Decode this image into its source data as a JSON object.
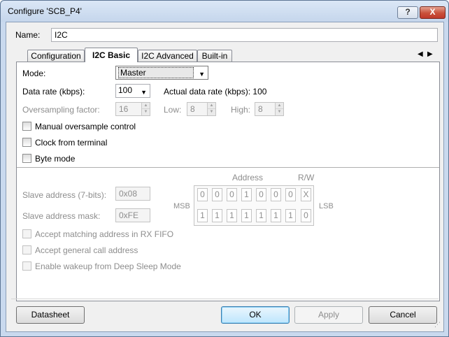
{
  "window": {
    "title": "Configure 'SCB_P4'",
    "help_label": "?",
    "close_label": "X"
  },
  "name_field": {
    "label": "Name:",
    "value": "I2C"
  },
  "tabs": [
    {
      "label": "Configuration",
      "active": false
    },
    {
      "label": "I2C Basic",
      "active": true
    },
    {
      "label": "I2C Advanced",
      "active": false
    },
    {
      "label": "Built-in",
      "active": false
    }
  ],
  "tab_scroll": {
    "left": "◀",
    "right": "▶"
  },
  "mode": {
    "label": "Mode:",
    "value": "Master"
  },
  "data_rate": {
    "label": "Data rate (kbps):",
    "value": "100",
    "actual_label": "Actual data rate (kbps): 100"
  },
  "oversampling": {
    "label": "Oversampling factor:",
    "value": "16",
    "low_label": "Low:",
    "low_value": "8",
    "high_label": "High:",
    "high_value": "8"
  },
  "checkboxes": [
    {
      "label": "Manual oversample control",
      "checked": false
    },
    {
      "label": "Clock from terminal",
      "checked": false
    },
    {
      "label": "Byte mode",
      "checked": false
    }
  ],
  "slave": {
    "address_label": "Slave address (7-bits):",
    "address_value": "0x08",
    "mask_label": "Slave address mask:",
    "mask_value": "0xFE",
    "address_header": "Address",
    "rw_header": "R/W",
    "msb_label": "MSB",
    "lsb_label": "LSB",
    "address_bits": [
      "0",
      "0",
      "0",
      "1",
      "0",
      "0",
      "0"
    ],
    "address_rw": "X",
    "mask_bits": [
      "1",
      "1",
      "1",
      "1",
      "1",
      "1",
      "1"
    ],
    "mask_rw": "0"
  },
  "disabled_checkboxes": [
    {
      "label": "Accept matching address in RX FIFO"
    },
    {
      "label": "Accept general call address"
    },
    {
      "label": "Enable wakeup from Deep Sleep Mode"
    }
  ],
  "buttons": {
    "datasheet": "Datasheet",
    "ok": "OK",
    "apply": "Apply",
    "cancel": "Cancel"
  },
  "colors": {
    "title_bar": "#c5d6ec",
    "panel": "#ffffff",
    "default_button": "#bee6fd"
  }
}
